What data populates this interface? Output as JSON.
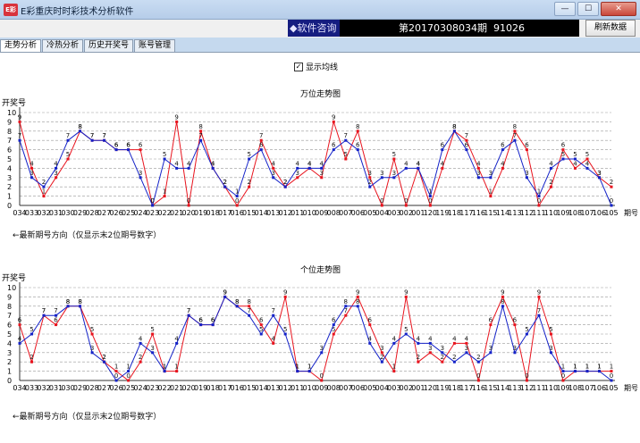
{
  "window": {
    "title": "E彩重庆时时彩技术分析软件",
    "icon_text": "E彩",
    "minimize": "—",
    "maximize": "☐",
    "close": "✕"
  },
  "header": {
    "consult": "◆软件咨询",
    "issue_label": "第20170308034期",
    "winning_number": "91026",
    "refresh_label": "刷新数据"
  },
  "tabs": [
    {
      "label": "走势分析",
      "active": true
    },
    {
      "label": "冷热分析",
      "active": false
    },
    {
      "label": "历史开奖号",
      "active": false
    },
    {
      "label": "账号管理",
      "active": false
    }
  ],
  "show_average": {
    "label": "显示均线",
    "checked": true
  },
  "colors": {
    "actual": "#e8141e",
    "average": "#1422c8",
    "grid": "#999999"
  },
  "chart_data": [
    {
      "type": "line",
      "title": "万位走势图",
      "ylabel": "开奖号",
      "xlabel": "期号",
      "ylim": [
        0,
        10
      ],
      "grid": true,
      "categories": [
        "034",
        "033",
        "032",
        "031",
        "030",
        "029",
        "028",
        "027",
        "026",
        "025",
        "024",
        "023",
        "022",
        "021",
        "020",
        "019",
        "018",
        "017",
        "016",
        "015",
        "014",
        "013",
        "012",
        "011",
        "010",
        "009",
        "008",
        "007",
        "006",
        "005",
        "004",
        "003",
        "002",
        "001",
        "120",
        "119",
        "118",
        "117",
        "116",
        "115",
        "114",
        "113",
        "112",
        "111",
        "110",
        "109",
        "108",
        "107",
        "106",
        "105"
      ],
      "series": [
        {
          "color": "#e8141e",
          "values": [
            9,
            4,
            1,
            3,
            5,
            8,
            7,
            7,
            6,
            6,
            6,
            0,
            1,
            9,
            0,
            8,
            4,
            2,
            0,
            2,
            7,
            4,
            2,
            3,
            4,
            3,
            9,
            5,
            8,
            3,
            0,
            5,
            0,
            4,
            0,
            4,
            8,
            7,
            4,
            1,
            4,
            8,
            6,
            0,
            2,
            6,
            4,
            5,
            3,
            2
          ]
        },
        {
          "color": "#1422c8",
          "values": [
            7,
            3,
            2,
            4,
            7,
            8,
            7,
            7,
            6,
            6,
            3,
            0,
            5,
            4,
            4,
            7,
            4,
            2,
            1,
            5,
            6,
            3,
            2,
            4,
            4,
            4,
            6,
            7,
            6,
            2,
            3,
            3,
            4,
            4,
            1,
            6,
            8,
            6,
            3,
            3,
            6,
            7,
            3,
            1,
            4,
            5,
            5,
            4,
            3,
            0
          ]
        }
      ],
      "hint": "←最新期号方向（仅显示末2位期号数字）"
    },
    {
      "type": "line",
      "title": "个位走势图",
      "ylabel": "开奖号",
      "xlabel": "期号",
      "ylim": [
        0,
        10
      ],
      "grid": true,
      "categories": [
        "034",
        "033",
        "032",
        "031",
        "030",
        "029",
        "028",
        "027",
        "026",
        "025",
        "024",
        "023",
        "022",
        "021",
        "020",
        "019",
        "018",
        "017",
        "016",
        "015",
        "014",
        "013",
        "012",
        "011",
        "010",
        "009",
        "008",
        "007",
        "006",
        "005",
        "004",
        "003",
        "002",
        "001",
        "120",
        "119",
        "118",
        "117",
        "116",
        "115",
        "114",
        "113",
        "112",
        "111",
        "110",
        "109",
        "108",
        "107",
        "106",
        "105"
      ],
      "series": [
        {
          "color": "#e8141e",
          "values": [
            6,
            2,
            7,
            6,
            8,
            8,
            5,
            2,
            1,
            0,
            2,
            5,
            1,
            1,
            7,
            6,
            6,
            9,
            8,
            8,
            6,
            4,
            9,
            1,
            1,
            0,
            5,
            7,
            9,
            6,
            3,
            1,
            9,
            2,
            3,
            2,
            4,
            4,
            0,
            6,
            9,
            6,
            0,
            9,
            5,
            0,
            1,
            1,
            1,
            1
          ]
        },
        {
          "color": "#1422c8",
          "values": [
            4,
            5,
            7,
            7,
            8,
            8,
            3,
            2,
            0,
            1,
            4,
            3,
            1,
            4,
            7,
            6,
            6,
            9,
            8,
            7,
            5,
            7,
            5,
            1,
            1,
            3,
            6,
            8,
            8,
            4,
            2,
            4,
            5,
            4,
            4,
            3,
            2,
            3,
            2,
            3,
            8,
            3,
            5,
            7,
            3,
            1,
            1,
            1,
            1,
            0
          ]
        }
      ],
      "hint": "←最新期号方向（仅显示末2位期号数字）"
    }
  ]
}
